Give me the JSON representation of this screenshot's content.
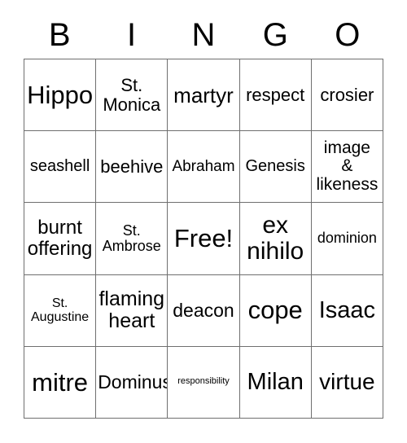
{
  "card": {
    "header_letters": [
      "B",
      "I",
      "N",
      "G",
      "O"
    ],
    "grid": {
      "rows": 5,
      "columns": 5,
      "border_color": "#6f6f6f",
      "background_color": "#ffffff",
      "text_color": "#000000"
    },
    "cells": [
      {
        "text": "Hippo",
        "font_size": "31px",
        "free": false
      },
      {
        "text": "St.\nMonica",
        "font_size": "22px",
        "free": false
      },
      {
        "text": "martyr",
        "font_size": "26px",
        "free": false
      },
      {
        "text": "respect",
        "font_size": "22px",
        "free": false
      },
      {
        "text": "crosier",
        "font_size": "22px",
        "free": false
      },
      {
        "text": "seashell",
        "font_size": "20px",
        "free": false
      },
      {
        "text": "beehive",
        "font_size": "22px",
        "free": false
      },
      {
        "text": "Abraham",
        "font_size": "19px",
        "free": false
      },
      {
        "text": "Genesis",
        "font_size": "20px",
        "free": false
      },
      {
        "text": "image\n&\nlikeness",
        "font_size": "21px",
        "free": false
      },
      {
        "text": "burnt\noffering",
        "font_size": "24px",
        "free": false
      },
      {
        "text": "St.\nAmbrose",
        "font_size": "18px",
        "free": false
      },
      {
        "text": "Free!",
        "font_size": "31px",
        "free": true
      },
      {
        "text": "ex\nnihilo",
        "font_size": "30px",
        "free": false
      },
      {
        "text": "dominion",
        "font_size": "18px",
        "free": false
      },
      {
        "text": "St.\nAugustine",
        "font_size": "16px",
        "free": false
      },
      {
        "text": "flaming\nheart",
        "font_size": "25px",
        "free": false
      },
      {
        "text": "deacon",
        "font_size": "23px",
        "free": false
      },
      {
        "text": "cope",
        "font_size": "31px",
        "free": false
      },
      {
        "text": "Isaac",
        "font_size": "29px",
        "free": false
      },
      {
        "text": "mitre",
        "font_size": "31px",
        "free": false
      },
      {
        "text": "Dominus",
        "font_size": "23px",
        "free": false
      },
      {
        "text": "responsibility",
        "font_size": "11px",
        "free": false
      },
      {
        "text": "Milan",
        "font_size": "29px",
        "free": false
      },
      {
        "text": "virtue",
        "font_size": "28px",
        "free": false
      }
    ]
  }
}
